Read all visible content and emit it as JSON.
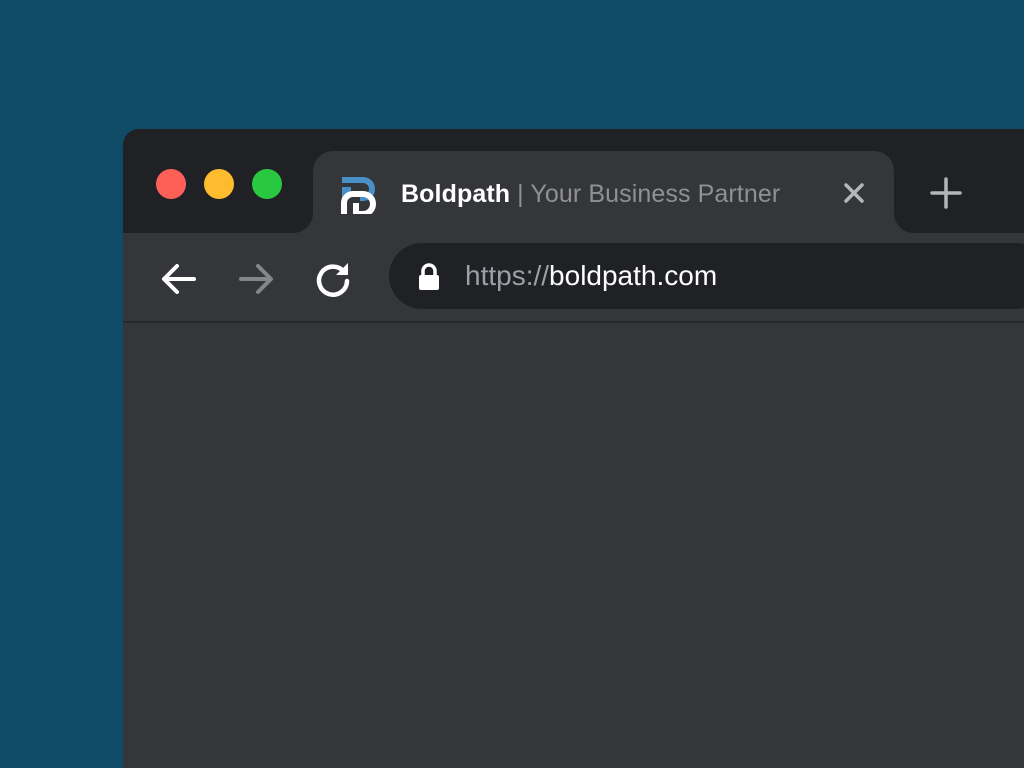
{
  "window": {
    "traffic_lights": {
      "close_color": "#fe5f57",
      "minimize_color": "#febc2e",
      "maximize_color": "#28c840"
    }
  },
  "tab": {
    "favicon": "boldpath-logo-icon",
    "title_brand": "Boldpath",
    "title_separator": " | ",
    "title_rest": "Your Business Partner",
    "close_icon": "close-icon"
  },
  "tabstrip": {
    "new_tab_icon": "plus-icon"
  },
  "toolbar": {
    "back_icon": "arrow-left-icon",
    "forward_icon": "arrow-right-icon",
    "reload_icon": "reload-icon"
  },
  "address_bar": {
    "lock_icon": "lock-icon",
    "scheme": "https://",
    "host": "boldpath.com"
  },
  "colors": {
    "desktop_background": "#0f4b67",
    "tabstrip_background": "#202124",
    "toolbar_background": "#35363a",
    "brand_blue": "#4a90c8"
  }
}
